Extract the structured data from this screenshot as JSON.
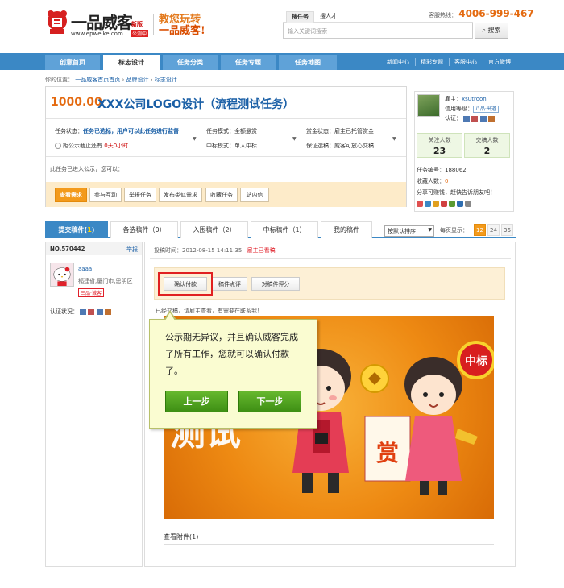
{
  "header": {
    "logo_text": "一品威客",
    "logo_url": "www.epweike.com",
    "badge_new": "新版",
    "badge_beta": "公测中",
    "slogan_line1": "教您玩转",
    "slogan_line2": "一品威客!",
    "search_tabs": [
      "搜任务",
      "搜人才"
    ],
    "search_placeholder": "输入关键词搜索",
    "search_button": "搜索",
    "hotline_label": "客服热线：",
    "hotline_number": "4006-999-467"
  },
  "nav": {
    "items": [
      "创意首页",
      "标志设计",
      "任务分类",
      "任务专题",
      "任务地图"
    ],
    "active_index": 1,
    "right_links": [
      "新闻中心",
      "精彩专题",
      "客服中心",
      "官方微博"
    ]
  },
  "breadcrumb": {
    "prefix": "你的位置：",
    "items": [
      "一品威客首页首页",
      "品牌设计",
      "标志设计"
    ]
  },
  "task": {
    "price": "1000.00",
    "title": "XXX公司LOGO设计（流程测试任务）",
    "status_label": "任务状态：",
    "status_value": "任务已选标，用户可以此任务进行监督",
    "countdown_prefix": "距公示截止还有",
    "countdown_value": "0天0小时",
    "mode_label": "任务模式：",
    "mode_value": "全额悬赏",
    "bid_label": "中标模式：",
    "bid_value": "单人中标",
    "reward_label": "赏金状态：",
    "reward_value": "雇主已托管赏金",
    "guarantee_label": "保证选稿：",
    "guarantee_value": "威客可放心交稿",
    "note": "此任务已进入公示，您可以：",
    "actions": [
      "查看需求",
      "参与互动",
      "举报任务",
      "发布类似需求",
      "收藏任务",
      "站内信"
    ]
  },
  "employer": {
    "role_label": "雇主：",
    "name": "xsutroon",
    "credit_label": "信用等级：",
    "credit_badge": "八品·出道",
    "auth_label": "认证：",
    "followers_label": "关注人数",
    "followers": "23",
    "deals_label": "交稿人数",
    "deals": "2",
    "task_id_label": "任务编号：",
    "task_id": "188062",
    "fav_label": "收藏人数：",
    "fav": "0",
    "share_text": "分享可赚钱，赶快告诉朋友吧！"
  },
  "tabs": {
    "items": [
      "提交稿件",
      "备选稿件（0）",
      "入围稿件（2）",
      "中标稿件（1）",
      "我的稿件"
    ],
    "first_count": "1",
    "sort_label": "按默认排序",
    "perpage_label": "每页显示：",
    "pages": [
      "12",
      "24",
      "36"
    ]
  },
  "entry": {
    "number": "NO.570442",
    "report": "举报",
    "user": "aaaa",
    "location": "福建省,厦门市,思明区",
    "level": "三品·诚客",
    "auth_label": "认证状况：",
    "time_label": "投稿时间：",
    "time": "2012-08-15 14:11:35",
    "seen": "雇主已看稿",
    "buttons": [
      "确认付款",
      "稿件点评",
      "对稿件评分"
    ],
    "hint": "已经交稿，请雇主查看，有需要在联系我！",
    "attach": "查看附件(1)",
    "artwork_text": "测试",
    "artwork_badge": "中标",
    "artwork_reward": "赏"
  },
  "tooltip": {
    "text": "公示期无异议，并且确认威客完成了所有工作，您就可以确认付款了。",
    "prev": "上一步",
    "next": "下一步"
  },
  "colors": {
    "brand_blue": "#3b88c5",
    "accent_orange": "#f39a1b",
    "price_orange": "#e46a10",
    "link_blue": "#1a5fa6",
    "tip_green": "#4fa321"
  }
}
